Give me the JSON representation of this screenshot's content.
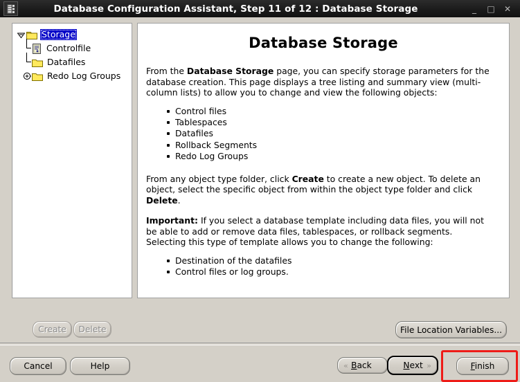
{
  "window": {
    "title": "Database Configuration Assistant, Step 11 of 12 : Database Storage",
    "icon": "database-icon",
    "minimize": "_",
    "maximize": "□",
    "close": "✕"
  },
  "tree": {
    "nodes": [
      {
        "label": "Storage",
        "level": 0,
        "icon": "folder-open-icon",
        "expander": "minus",
        "selected": true
      },
      {
        "label": "Controlfile",
        "level": 1,
        "icon": "controlfile-icon",
        "expander": "none",
        "selected": false
      },
      {
        "label": "Datafiles",
        "level": 1,
        "icon": "folder-icon",
        "expander": "none",
        "selected": false
      },
      {
        "label": "Redo Log Groups",
        "level": 1,
        "icon": "folder-icon",
        "expander": "plus",
        "selected": false
      }
    ]
  },
  "content": {
    "heading": "Database Storage",
    "paragraph1": {
      "a": "From the ",
      "bold": "Database Storage",
      "b": " page, you can specify storage parameters for the database creation. This page displays a tree listing and summary view (multi-column lists) to allow you to change and view the following objects:"
    },
    "list1": [
      "Control files",
      "Tablespaces",
      "Datafiles",
      "Rollback Segments",
      "Redo Log Groups"
    ],
    "paragraph2": {
      "a": "From any object type folder, click ",
      "bold1": "Create",
      "b": " to create a new object. To delete an object, select the specific object from within the object type folder and click ",
      "bold2": "Delete",
      "c": "."
    },
    "paragraph3": {
      "bold": "Important:",
      "a": " If you select a database template including data files, you will not be able to add or remove data files, tablespaces, or rollback segments. Selecting this type of template allows you to change the following:"
    },
    "list2": [
      "Destination of the datafiles",
      "Control files or log groups."
    ]
  },
  "buttons": {
    "create": "Create",
    "delete": "Delete",
    "file_location_variables": "File Location Variables...",
    "cancel": "Cancel",
    "help": "Help",
    "back": "Back",
    "back_mnemonic": "B",
    "next": "Next",
    "next_mnemonic": "N",
    "finish": "Finish",
    "finish_mnemonic": "F",
    "back_chevron": "«",
    "next_chevron": "»"
  },
  "annotation": {
    "highlight_color": "#ee1b17",
    "target": "finish-button"
  }
}
